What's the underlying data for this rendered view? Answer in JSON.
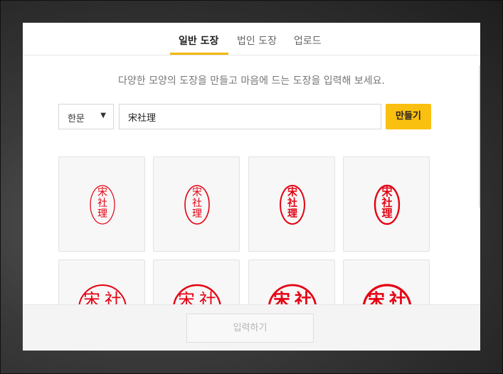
{
  "tabs": [
    {
      "label": "일반 도장",
      "active": true
    },
    {
      "label": "법인 도장",
      "active": false
    },
    {
      "label": "업로드",
      "active": false
    }
  ],
  "description": "다양한 모양의 도장을 만들고 마음에 드는 도장을 입력해 보세요.",
  "script_select": {
    "value": "한문",
    "caret": "▼"
  },
  "name_input": {
    "value": "宋社理"
  },
  "make_button": {
    "label": "만들기"
  },
  "stamps": [
    {
      "chars": [
        "宋",
        "社",
        "理"
      ],
      "style": "vertical-seal-thin"
    },
    {
      "chars": [
        "宋",
        "社",
        "理"
      ],
      "style": "vertical-regular"
    },
    {
      "chars": [
        "宋",
        "社",
        "理"
      ],
      "style": "vertical-bold"
    },
    {
      "chars": [
        "宋",
        "社",
        "理"
      ],
      "style": "vertical-heavy"
    },
    {
      "chars": [
        "宋",
        "社"
      ],
      "style": "round-seal-thin"
    },
    {
      "chars": [
        "宋",
        "社"
      ],
      "style": "round-regular"
    },
    {
      "chars": [
        "宋",
        "社"
      ],
      "style": "round-bold"
    },
    {
      "chars": [
        "宋",
        "社"
      ],
      "style": "round-heavy"
    }
  ],
  "submit_button": {
    "label": "입력하기"
  },
  "colors": {
    "accent": "#fac00f",
    "stamp_red": "#e60012",
    "tab_underline": "#f2b705"
  }
}
